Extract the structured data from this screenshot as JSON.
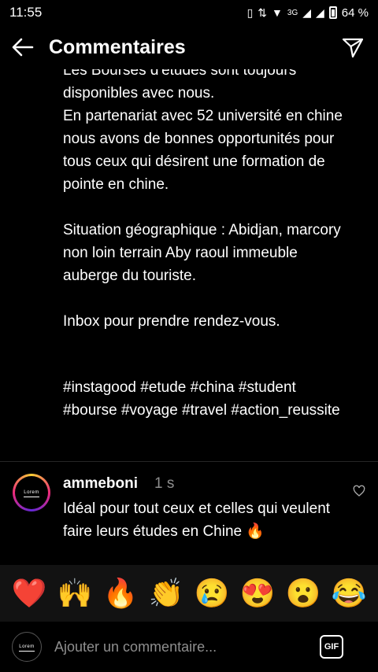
{
  "status_bar": {
    "time": "11:55",
    "network": "3G",
    "battery": "64 %"
  },
  "header": {
    "title": "Commentaires"
  },
  "caption": {
    "text": "Les Bourses d'études sont toujours\ndisponibles avec nous.\nEn partenariat avec 52 université en chine nous avons de bonnes opportunités pour tous ceux qui désirent une formation de pointe en chine.\n\nSituation géographique : Abidjan, marcory non loin terrain Aby raoul immeuble auberge du touriste.\n\nInbox pour prendre rendez-vous.",
    "hashtags": "#instagood #etude #china #student #bourse #voyage #travel #action_reussite"
  },
  "comment": {
    "username": "ammeboni",
    "time": "1 s",
    "text": "Idéal pour tout ceux et celles qui veulent faire leurs études en Chine 🔥",
    "avatar_text": "Lorem"
  },
  "emoji_bar": {
    "items": [
      "❤️",
      "🙌",
      "🔥",
      "👏",
      "😢",
      "😍",
      "😮",
      "😂"
    ]
  },
  "input": {
    "placeholder": "Ajouter un commentaire...",
    "gif_label": "GIF"
  }
}
